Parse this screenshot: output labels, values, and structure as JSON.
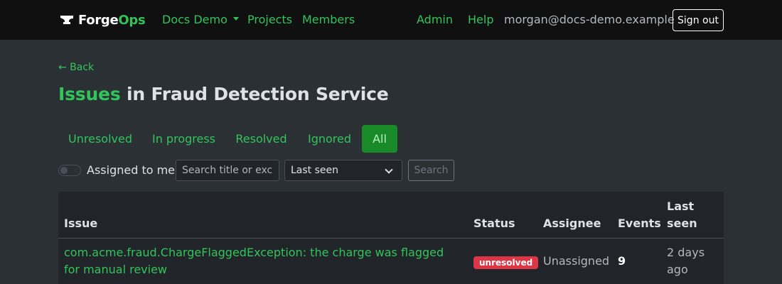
{
  "navbar": {
    "brand_main": "Forge",
    "brand_accent": "Ops",
    "org_menu": "Docs Demo",
    "projects": "Projects",
    "members": "Members",
    "admin": "Admin",
    "help": "Help",
    "user_email": "morgan@docs-demo.example",
    "sign_out": "Sign out"
  },
  "page": {
    "back": "← Back",
    "title_accent": "Issues",
    "title_rest": " in Fraud Detection Service"
  },
  "tabs": [
    {
      "label": "Unresolved",
      "active": false
    },
    {
      "label": "In progress",
      "active": false
    },
    {
      "label": "Resolved",
      "active": false
    },
    {
      "label": "Ignored",
      "active": false
    },
    {
      "label": "All",
      "active": true
    }
  ],
  "filters": {
    "assigned_label": "Assigned to me",
    "assigned_on": false,
    "search_placeholder": "Search title or exception",
    "sort_value": "Last seen",
    "search_button": "Search"
  },
  "table": {
    "columns": [
      "Issue",
      "Status",
      "Assignee",
      "Events",
      "Last seen"
    ],
    "rows": [
      {
        "issue": "com.acme.fraud.ChargeFlaggedException: the charge was flagged for manual review",
        "status": "unresolved",
        "assignee": "Unassigned",
        "events": "9",
        "last_seen": "2 days ago"
      }
    ]
  },
  "colors": {
    "accent": "#32c45a",
    "navbar_bg": "#101010",
    "page_bg": "#2b3035",
    "active_tab_bg": "#198a28",
    "status_unresolved": "#dc3545"
  },
  "icons": {
    "brand": "anvil-icon",
    "org_dropdown": "caret-down-icon",
    "sort_dropdown": "chevron-down-icon"
  }
}
